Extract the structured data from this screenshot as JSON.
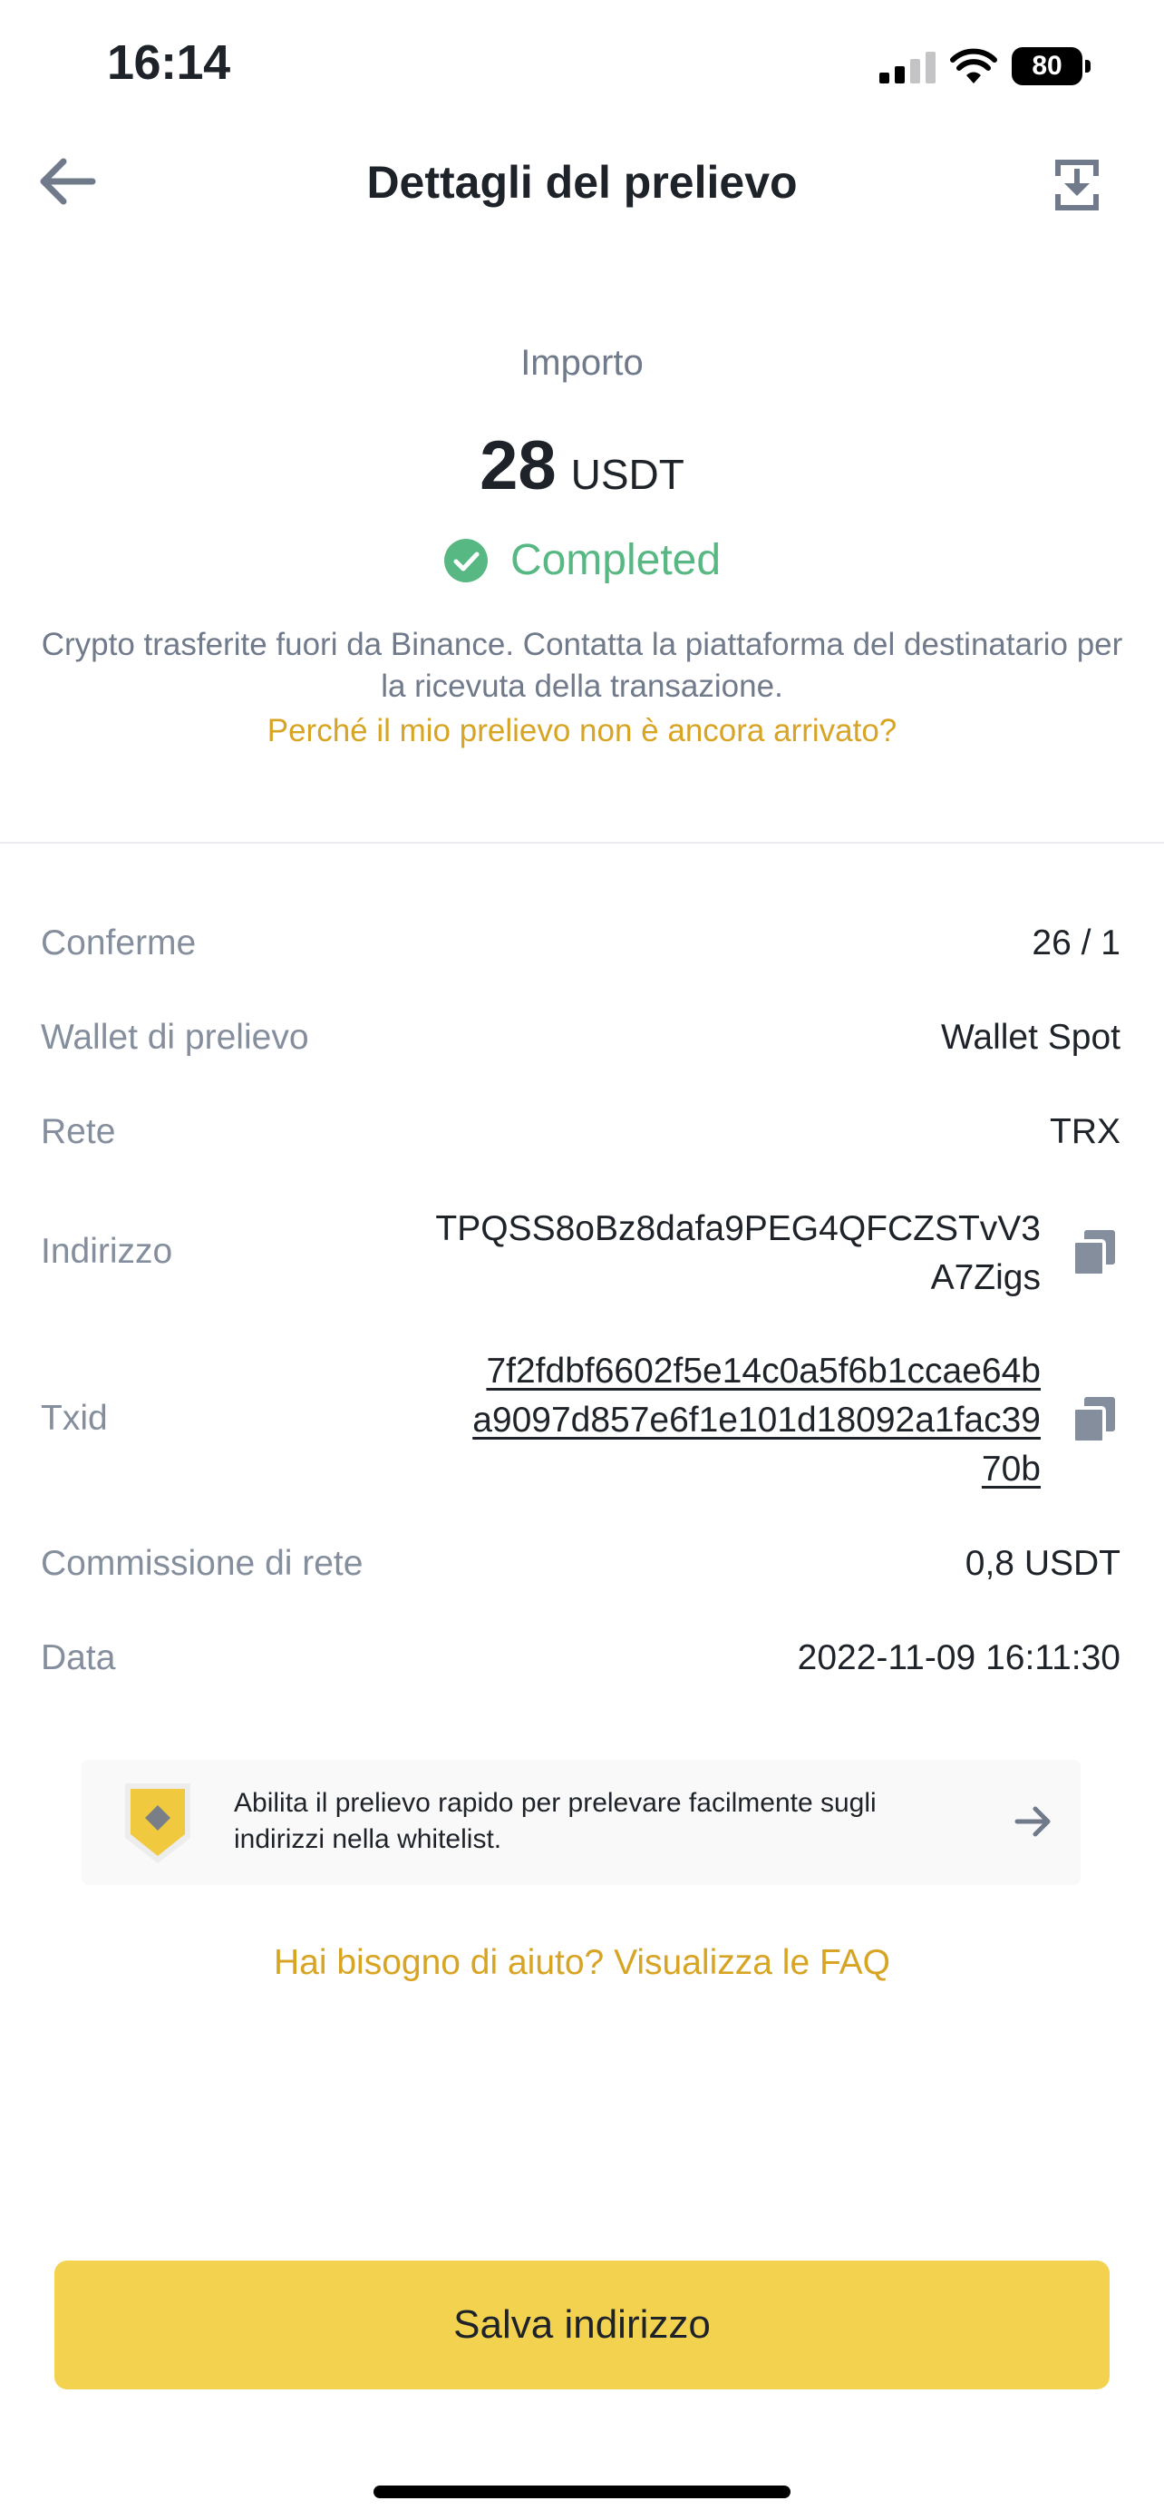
{
  "status_bar": {
    "time": "16:14",
    "battery": "80"
  },
  "header": {
    "title": "Dettagli del prelievo",
    "back_icon": "arrow-left-icon",
    "action_icon": "download-icon"
  },
  "amount": {
    "label": "Importo",
    "value": "28",
    "unit": "USDT",
    "status": "Completed",
    "status_color": "#58B883",
    "description": "Crypto trasferite fuori da Binance. Contatta la piattaforma del destinatario per la ricevuta della transazione.",
    "help_link": "Perché il mio prelievo non è ancora arrivato?"
  },
  "details": {
    "confirmations": {
      "label": "Conferme",
      "value": "26 / 1"
    },
    "wallet": {
      "label": "Wallet di prelievo",
      "value": "Wallet Spot"
    },
    "network": {
      "label": "Rete",
      "value": "TRX"
    },
    "address": {
      "label": "Indirizzo",
      "line1": "TPQSS8oBz8dafa9PEG4QFCZSTvV3",
      "line2": "A7Zigs"
    },
    "txid": {
      "label": "Txid",
      "line1": "7f2fdbf6602f5e14c0a5f6b1ccae64b",
      "line2": "a9097d857e6f1e101d18092a1fac39",
      "line3": "70b"
    },
    "fee": {
      "label": "Commissione di rete",
      "value": "0,8 USDT"
    },
    "date": {
      "label": "Data",
      "value": "2022-11-09 16:11:30"
    }
  },
  "promo": {
    "text": "Abilita il prelievo rapido per prelevare facilmente sugli indirizzi nella whitelist.",
    "icon": "shield-icon"
  },
  "faq_link": "Hai bisogno di aiuto? Visualizza le FAQ",
  "save_button": "Salva indirizzo",
  "colors": {
    "accent": "#F3D250",
    "link": "#D8A424",
    "muted": "#848E9C"
  }
}
